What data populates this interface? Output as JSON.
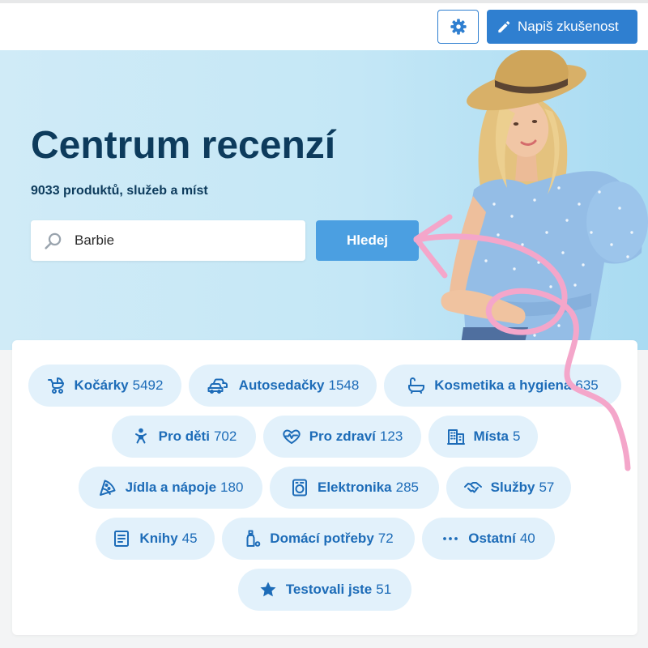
{
  "header": {
    "settings_button": {
      "icon": "gear-icon"
    },
    "write_review_button": {
      "label": "Napiš zkušenost",
      "icon": "pencil-icon"
    }
  },
  "hero": {
    "title": "Centrum recenzí",
    "subtitle": "9033 produktů, služeb a míst",
    "search": {
      "value": "Barbie",
      "icon": "search-icon"
    },
    "search_button": {
      "label": "Hledej"
    }
  },
  "categories": [
    {
      "label": "Kočárky",
      "count": "5492",
      "icon": "stroller-icon"
    },
    {
      "label": "Autosedačky",
      "count": "1548",
      "icon": "car-icon"
    },
    {
      "label": "Kosmetika a hygiena",
      "count": "635",
      "icon": "bathtub-icon"
    },
    {
      "label": "Pro děti",
      "count": "702",
      "icon": "baby-icon"
    },
    {
      "label": "Pro zdraví",
      "count": "123",
      "icon": "heart-pulse-icon"
    },
    {
      "label": "Místa",
      "count": "5",
      "icon": "building-icon"
    },
    {
      "label": "Jídla a nápoje",
      "count": "180",
      "icon": "pizza-icon"
    },
    {
      "label": "Elektronika",
      "count": "285",
      "icon": "washing-machine-icon"
    },
    {
      "label": "Služby",
      "count": "57",
      "icon": "handshake-icon"
    },
    {
      "label": "Knihy",
      "count": "45",
      "icon": "book-icon"
    },
    {
      "label": "Domácí potřeby",
      "count": "72",
      "icon": "household-icon"
    },
    {
      "label": "Ostatní",
      "count": "40",
      "icon": "dots-icon"
    },
    {
      "label": "Testovali jste",
      "count": "51",
      "icon": "star-icon"
    }
  ],
  "colors": {
    "accent": "#2f7fd0",
    "search_button": "#4b9fe1",
    "title": "#0d3b5c",
    "pill_background": "#e2f1fb",
    "pill_text": "#1d6cb8",
    "annotation": "#f4a6ca"
  }
}
